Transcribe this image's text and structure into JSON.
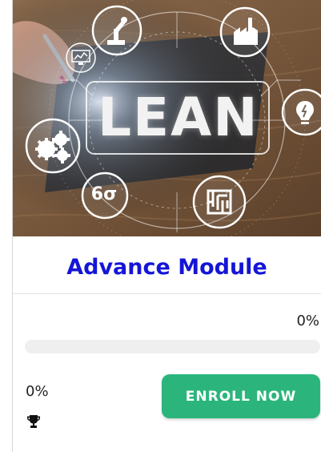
{
  "hero": {
    "image_text": "LEAN",
    "sigma_text": "6σ"
  },
  "course": {
    "title": "Advance Module",
    "progress_text": "0%",
    "progress_value": 0,
    "score_text": "0%",
    "enroll_label": "ENROLL NOW"
  },
  "colors": {
    "title": "#1515d6",
    "button": "#2bb57c",
    "track": "#efefef"
  },
  "icons": [
    "gears-icon",
    "robot-arm-icon",
    "factory-icon",
    "lightbulb-icon",
    "chart-monitor-icon",
    "maze-icon",
    "trophy-icon"
  ]
}
